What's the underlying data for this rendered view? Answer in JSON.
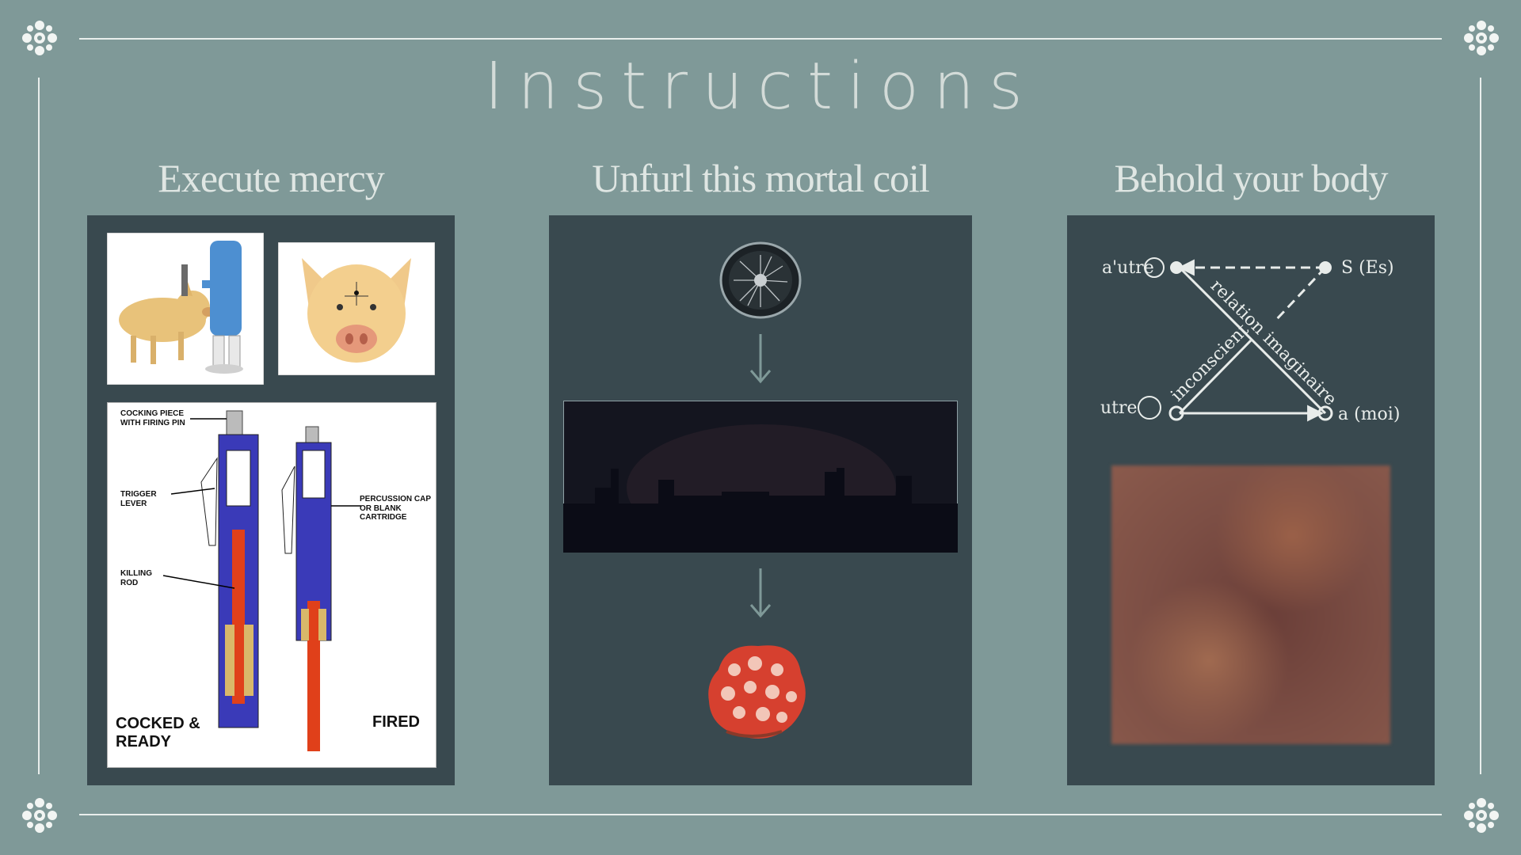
{
  "page": {
    "title": "Instructions"
  },
  "columns": [
    {
      "heading": "Execute mercy"
    },
    {
      "heading": "Unfurl this mortal coil"
    },
    {
      "heading": "Behold your body"
    }
  ],
  "stun_diagram": {
    "label_cocking": "COCKING PIECE WITH FIRING PIN",
    "label_trigger": "TRIGGER LEVER",
    "label_percussion": "PERCUSSION CAP OR BLANK CARTRIDGE",
    "label_killing": "KILLING ROD",
    "label_cocked": "COCKED & READY",
    "label_fired": "FIRED"
  },
  "schema": {
    "es_s": "S (Es)",
    "autre_top": "a'utre",
    "moi": "a (moi)",
    "autre_bottom": "utre",
    "relation": "relation imaginaire",
    "inconscient": "inconscient"
  },
  "colors": {
    "background": "#7f9998",
    "panel": "#39494f",
    "frame": "#e9eeec"
  }
}
